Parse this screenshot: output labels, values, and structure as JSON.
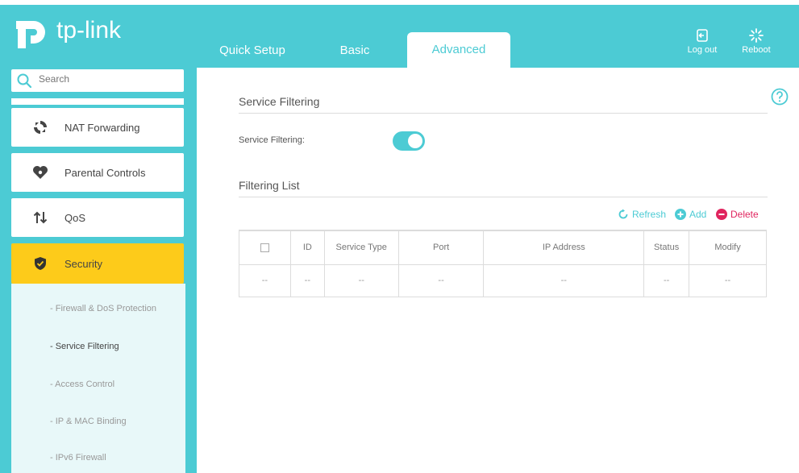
{
  "brand": {
    "name": "tp-link",
    "color": "#4ccbd4"
  },
  "header": {
    "tabs": [
      {
        "label": "Quick Setup",
        "active": false
      },
      {
        "label": "Basic",
        "active": false
      },
      {
        "label": "Advanced",
        "active": true
      }
    ],
    "logout_label": "Log out",
    "reboot_label": "Reboot"
  },
  "sidebar": {
    "search_placeholder": "Search",
    "items": [
      {
        "label": "NAT Forwarding",
        "icon": "nat-icon"
      },
      {
        "label": "Parental Controls",
        "icon": "heart-icon"
      },
      {
        "label": "QoS",
        "icon": "qos-arrows-icon"
      },
      {
        "label": "Security",
        "icon": "shield-icon",
        "active": true
      }
    ],
    "active_color": "#fdcb1a",
    "subitems": [
      {
        "label": "- Firewall & DoS Protection"
      },
      {
        "label": "- Service Filtering",
        "active": true
      },
      {
        "label": "- Access Control"
      },
      {
        "label": "- IP & MAC Binding"
      },
      {
        "label": "- IPv6 Firewall"
      }
    ]
  },
  "main": {
    "section1_title": "Service Filtering",
    "service_filtering_label": "Service Filtering:",
    "service_filtering_enabled": true,
    "section2_title": "Filtering List",
    "actions": {
      "refresh": "Refresh",
      "add": "Add",
      "delete": "Delete"
    },
    "table": {
      "headers": [
        "ID",
        "Service Type",
        "Port",
        "IP Address",
        "Status",
        "Modify"
      ],
      "rows": [
        [
          "--",
          "--",
          "--",
          "--",
          "--",
          "--",
          "--"
        ]
      ]
    }
  }
}
